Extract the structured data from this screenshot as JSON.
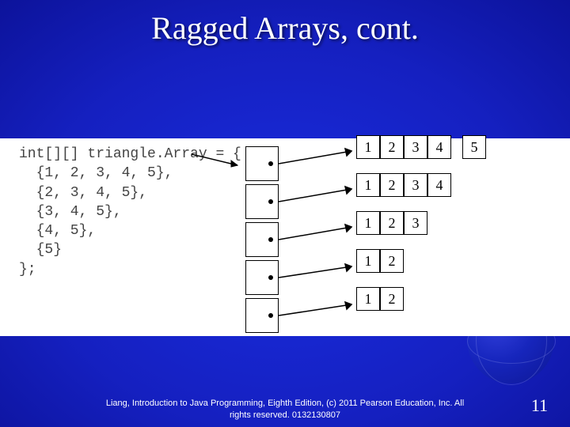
{
  "title": "Ragged Arrays, cont.",
  "code": {
    "l0": "int[][] triangle.Array = {",
    "l1": "  {1, 2, 3, 4, 5},",
    "l2": "  {2, 3, 4, 5},",
    "l3": "  {3, 4, 5},",
    "l4": "  {4, 5},",
    "l5": "  {5}",
    "l6": "};"
  },
  "rows": {
    "r0": {
      "c0": "1",
      "c1": "2",
      "c2": "3",
      "c3": "4",
      "c4": "5"
    },
    "r1": {
      "c0": "1",
      "c1": "2",
      "c2": "3",
      "c3": "4"
    },
    "r2": {
      "c0": "1",
      "c1": "2",
      "c2": "3"
    },
    "r3": {
      "c0": "1",
      "c1": "2"
    },
    "r4": {
      "c0": "1",
      "c1": "2"
    }
  },
  "footer_line1": "Liang, Introduction to Java Programming, Eighth Edition, (c) 2011 Pearson Education, Inc. All",
  "footer_line2": "rights reserved. 0132130807",
  "page_number": "11"
}
